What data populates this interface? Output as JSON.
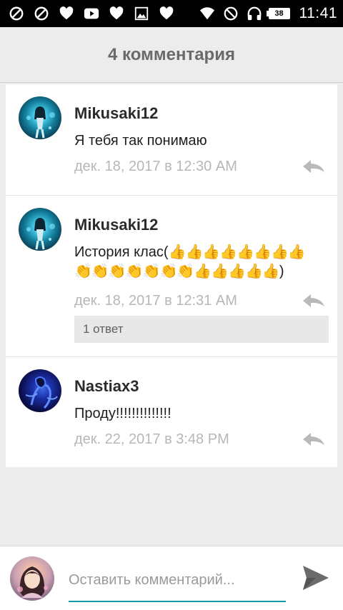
{
  "status_bar": {
    "time": "11:41",
    "battery_level": "38",
    "left_icons": [
      "blocked-icon",
      "blocked-icon",
      "heart-icon",
      "youtube-icon",
      "heart-icon",
      "gallery-icon",
      "heart-icon"
    ],
    "right_icons": [
      "wifi-icon",
      "do-not-disturb-icon",
      "headphones-icon",
      "battery-icon"
    ]
  },
  "header": {
    "title": "4 комментария"
  },
  "comments": [
    {
      "author": "Mikusaki12",
      "text": "Я тебя так понимаю",
      "date": "дек. 18, 2017 в 12:30 AM",
      "avatar": "anime-avatar-blue"
    },
    {
      "author": "Mikusaki12",
      "text_prefix": "История клас(",
      "text_emoji_1": "👍👍👍👍👍👍👍👍",
      "text_emoji_2": "👏👏👏👏👏👏👏👍👍👍👍👍",
      "text_suffix": ")",
      "date": "дек. 18, 2017 в 12:31 AM",
      "replies_label": "1 ответ",
      "avatar": "anime-avatar-blue"
    },
    {
      "author": "Nastiax3",
      "text": "Проду!!!!!!!!!!!!!!",
      "date": "дек. 22, 2017 в 3:48 PM",
      "avatar": "dark-blue-avatar"
    }
  ],
  "composer": {
    "placeholder": "Оставить комментарий...",
    "send_icon": "send-icon",
    "accent_color": "#159aa8"
  }
}
